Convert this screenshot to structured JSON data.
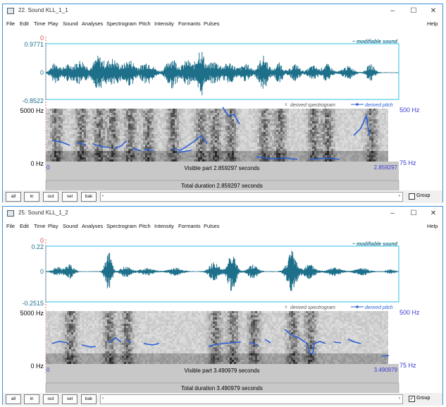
{
  "menu": [
    "File",
    "Edit",
    "Time",
    "Play",
    "Sound",
    "Analyses",
    "Spectrogram",
    "Pitch",
    "Intensity",
    "Formants",
    "Pulses"
  ],
  "help_label": "Help",
  "window_controls": {
    "minimize": "–",
    "maximize": "☐",
    "close": "✕"
  },
  "buttons": {
    "all": "all",
    "in": "in",
    "out": "out",
    "sel": "sel",
    "bak": "bak",
    "scroll_left": "‹",
    "scroll_right": "›"
  },
  "group_label": "Group",
  "labels": {
    "modifiable_sound": "~ modifiable sound",
    "derived_spectrogram": "derived spectrogram",
    "derived_pitch": "derived pitch",
    "freq_top": "5000 Hz",
    "freq_bottom": "0 Hz",
    "pitch_top": "500 Hz",
    "pitch_bottom": "75 Hz",
    "time_start": "0",
    "cursor_zero": "0"
  },
  "windows": [
    {
      "title": "22. Sound KLL_1_1",
      "wave_max": "0.9771",
      "wave_min": "-0.8522",
      "wave_zero": "0",
      "visible_part": "Visible part 2.859297 seconds",
      "visible_end": "2.859297",
      "total_duration": "Total duration 2.859297 seconds",
      "group_checked": false
    },
    {
      "title": "25. Sound KLL_1_2",
      "wave_max": "0.22",
      "wave_min": "-0.2515",
      "wave_zero": "0",
      "visible_part": "Visible part 3.490979 seconds",
      "visible_end": "3.490979",
      "total_duration": "Total duration 3.490979 seconds",
      "group_checked": true
    }
  ],
  "colors": {
    "waveform": "#1d6f8a",
    "pitch": "#2a5fd6",
    "plot_border": "#2ec0e8",
    "cursor": "#d44",
    "label_blue": "#3a3ad0",
    "label_teal": "#1d6f8a"
  }
}
